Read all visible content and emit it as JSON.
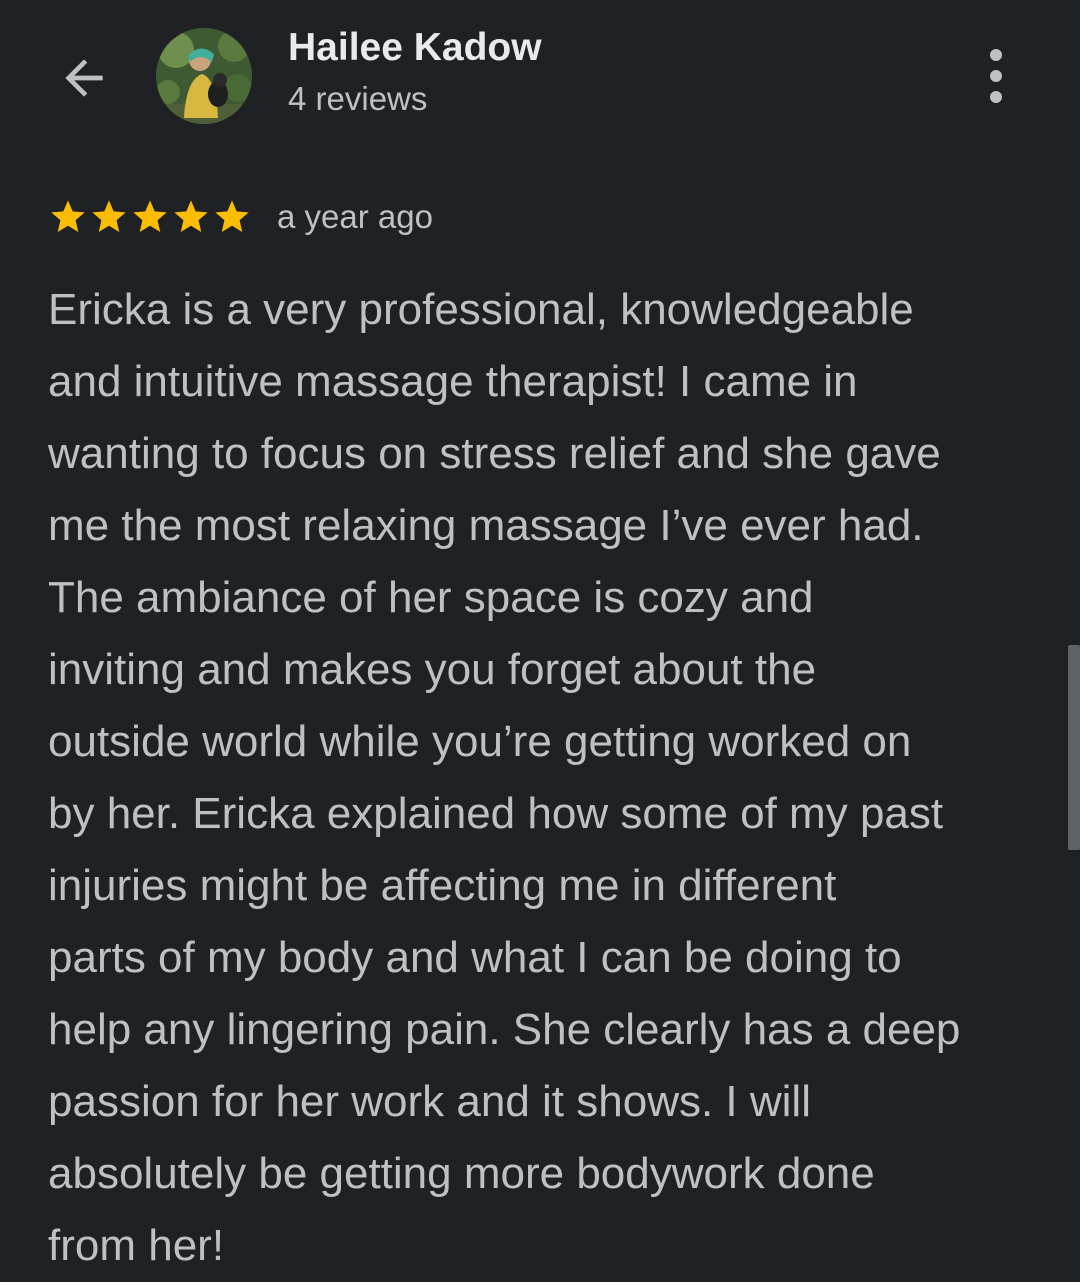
{
  "reviewer": {
    "name": "Hailee Kadow",
    "review_count": "4 reviews"
  },
  "icons": {
    "back": "arrow-back-icon",
    "more": "more-vert-icon",
    "star": "star-icon"
  },
  "review": {
    "rating": 5,
    "max_rating": 5,
    "time_ago": "a year ago",
    "lines": [
      "Ericka is a very professional, knowledgeable",
      "and intuitive massage therapist! I came in",
      "wanting to focus on stress relief and she gave",
      "me the most relaxing massage I’ve ever had.",
      "The ambiance of her space is cozy and",
      "inviting and makes you forget about the",
      "outside world while you’re getting worked on",
      "by her. Ericka explained how some of my past",
      "injuries might be affecting me in different",
      "parts of my body and what I can be doing to",
      "help any lingering pain. She clearly has a deep",
      "passion for her work and it shows. I will",
      "absolutely be getting more bodywork done",
      "from her!"
    ]
  },
  "colors": {
    "background": "#202124",
    "primary_text": "#e8eaed",
    "secondary_text": "#bdc1c6",
    "star": "#fbbc04",
    "scrollbar": "#5f6368"
  }
}
